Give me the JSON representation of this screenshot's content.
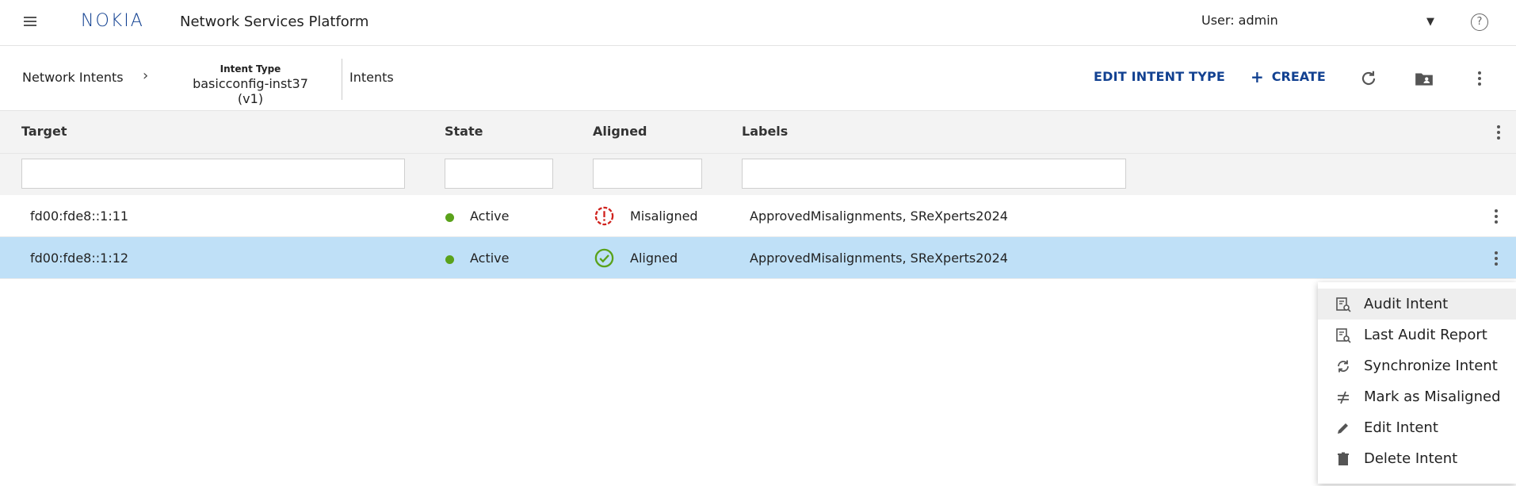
{
  "header": {
    "menu_icon": "hamburger-icon",
    "logo_text": "NOKIA",
    "app_title": "Network Services Platform",
    "user_label": "User: admin",
    "help_icon": "help-icon"
  },
  "subbar": {
    "crumb_root": "Network Intents",
    "intent_type_label": "Intent Type",
    "intent_type_value": "basicconfig-inst37 (v1)",
    "crumb_current": "Intents",
    "edit_label": "EDIT INTENT TYPE",
    "create_label": "CREATE",
    "refresh_icon": "refresh-icon",
    "folder_icon": "folder-user-icon",
    "more_icon": "kebab-icon"
  },
  "table": {
    "columns": [
      "Target",
      "State",
      "Aligned",
      "Labels"
    ],
    "rows": [
      {
        "target": "fd00:fde8::1:11",
        "state": "Active",
        "aligned": "Misaligned",
        "labels": "ApprovedMisalignments, SReXperts2024",
        "selected": false
      },
      {
        "target": "fd00:fde8::1:12",
        "state": "Active",
        "aligned": "Aligned",
        "labels": "ApprovedMisalignments, SReXperts2024",
        "selected": true
      }
    ]
  },
  "colors": {
    "brand": "#124191",
    "active_dot": "#5aa21b",
    "misaligned": "#d0211c",
    "aligned": "#5aa21b",
    "selected_row": "#bfe0f7"
  },
  "context_menu": {
    "items": [
      {
        "label": "Audit Intent",
        "icon": "audit-report-icon"
      },
      {
        "label": "Last Audit Report",
        "icon": "audit-report-icon"
      },
      {
        "label": "Synchronize Intent",
        "icon": "sync-icon"
      },
      {
        "label": "Mark as Misaligned",
        "icon": "not-equal-icon"
      },
      {
        "label": "Edit Intent",
        "icon": "pencil-icon"
      },
      {
        "label": "Delete Intent",
        "icon": "trash-icon"
      }
    ]
  }
}
